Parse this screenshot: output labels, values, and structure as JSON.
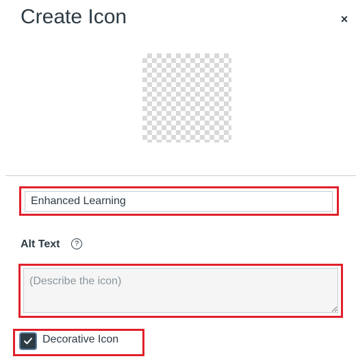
{
  "dialog": {
    "title": "Create Icon",
    "close_symbol": "×"
  },
  "preview": {
    "icon": "transparent-checkerboard"
  },
  "name_field": {
    "value": "Enhanced Learning"
  },
  "alt_text": {
    "label": "Alt Text",
    "help_symbol": "?",
    "placeholder": "(Describe the icon)"
  },
  "decorative": {
    "label": "Decorative Icon",
    "checked": true
  },
  "colors": {
    "highlight": "#e0202b",
    "checkbox_bg": "#2d3b45",
    "text": "#2d3b45"
  }
}
